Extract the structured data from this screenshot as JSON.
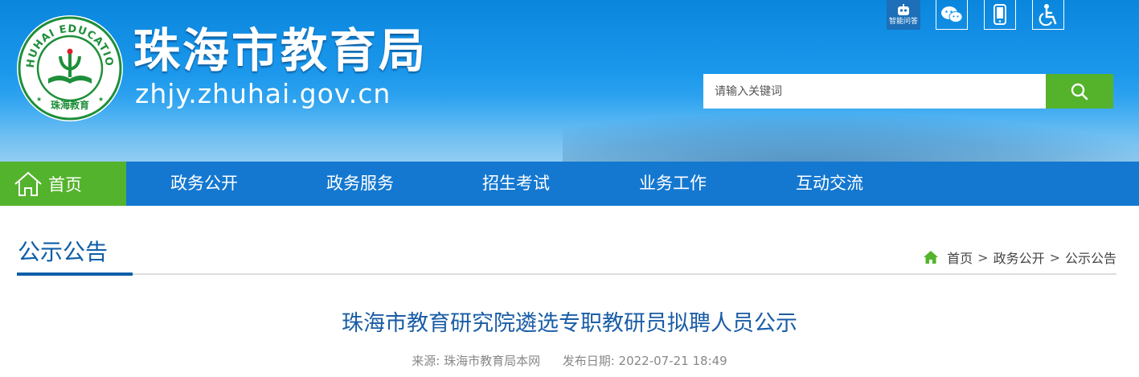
{
  "header": {
    "site_name": "珠海市教育局",
    "site_url": "zhjy.zhuhai.gov.cn",
    "logo": {
      "ring_text": "ZHUHAI EDUCATION",
      "bottom_text": "珠海教育",
      "colors": {
        "ring": "#1e8f3a",
        "inner": "#ffffff"
      }
    },
    "utilities": [
      {
        "name": "robot-icon",
        "label": "智能问答"
      },
      {
        "name": "wechat-icon"
      },
      {
        "name": "mobile-icon"
      },
      {
        "name": "accessibility-icon"
      }
    ],
    "search": {
      "placeholder": "请输入关键词",
      "button_icon": "search-icon"
    }
  },
  "nav": {
    "home_label": "首页",
    "items": [
      {
        "label": "政务公开"
      },
      {
        "label": "政务服务"
      },
      {
        "label": "招生考试"
      },
      {
        "label": "业务工作"
      },
      {
        "label": "互动交流"
      }
    ],
    "colors": {
      "bar": "#1478d0",
      "active": "#54b32c"
    }
  },
  "section": {
    "title": "公示公告",
    "breadcrumb": [
      "首页",
      "政务公开",
      "公示公告"
    ],
    "separator": ">"
  },
  "article": {
    "title": "珠海市教育研究院遴选专职教研员拟聘人员公示",
    "source_label": "来源:",
    "source_value": "珠海市教育局本网",
    "date_label": "发布日期:",
    "date_value": "2022-07-21 18:49"
  }
}
